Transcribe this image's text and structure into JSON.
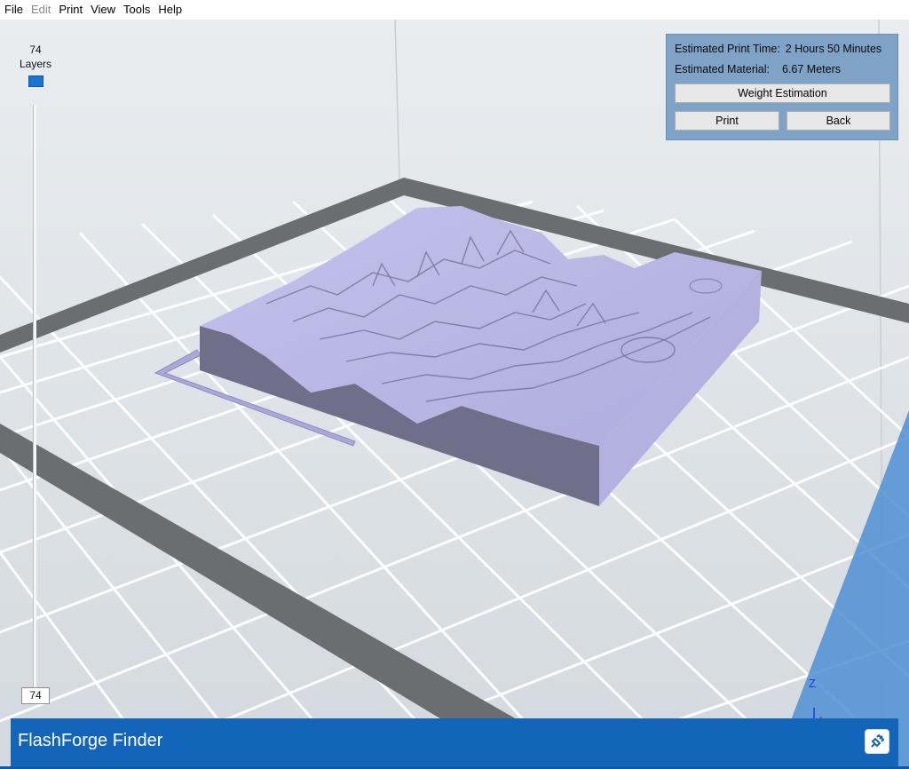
{
  "menubar": {
    "items": [
      {
        "label": "File",
        "enabled": true
      },
      {
        "label": "Edit",
        "enabled": false
      },
      {
        "label": "Print",
        "enabled": true
      },
      {
        "label": "View",
        "enabled": true
      },
      {
        "label": "Tools",
        "enabled": true
      },
      {
        "label": "Help",
        "enabled": true
      }
    ]
  },
  "layer_slider": {
    "count": "74",
    "label": "Layers",
    "input_value": "74"
  },
  "info_panel": {
    "print_time_label": "Estimated Print Time:",
    "print_time_value": "2 Hours 50 Minutes",
    "material_label": "Estimated Material:",
    "material_value": "6.67 Meters",
    "weight_button": "Weight Estimation",
    "print_button": "Print",
    "back_button": "Back"
  },
  "axis_gizmo": {
    "z_label": "Z"
  },
  "bottom_bar": {
    "printer_name": "FlashForge Finder",
    "connect_icon": "connect-icon"
  },
  "colors": {
    "accent": "#1265b8",
    "panel": "#7ea3c6",
    "model_top": "#b9b7e6",
    "model_side": "#6f6f8a",
    "build_plate_border": "#6b6e70",
    "grid_line": "#ffffff"
  }
}
